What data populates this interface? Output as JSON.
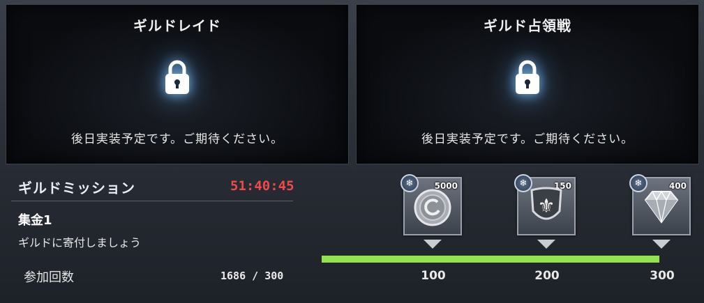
{
  "panels": [
    {
      "title": "ギルドレイド",
      "message": "後日実装予定です。ご期待ください。",
      "icon": "lock-icon"
    },
    {
      "title": "ギルド占領戦",
      "message": "後日実装予定です。ご期待ください。",
      "icon": "lock-icon"
    }
  ],
  "mission": {
    "title": "ギルドミッション",
    "timer": "51:40:45",
    "name": "集金1",
    "description": "ギルドに寄付しましょう",
    "count_label": "参加回数",
    "count_value": "1686 / 300"
  },
  "rewards": [
    {
      "icon": "coin-icon",
      "quantity": "5000",
      "milestone": "100"
    },
    {
      "icon": "guild-crest-icon",
      "quantity": "150",
      "milestone": "200"
    },
    {
      "icon": "diamond-icon",
      "quantity": "400",
      "milestone": "300"
    }
  ],
  "progress": {
    "fraction": 1.0
  },
  "colors": {
    "timer": "#ef4a4a",
    "progress": "#93e34a",
    "lock_glow": "#82c8ff"
  }
}
